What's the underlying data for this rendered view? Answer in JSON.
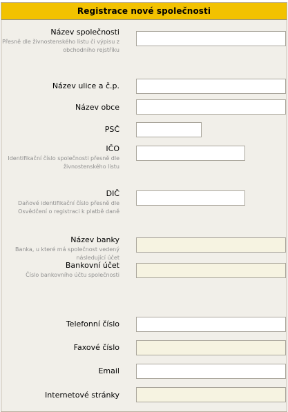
{
  "form": {
    "title": "Registrace nové společnosti",
    "fields": [
      {
        "label": "Název společnosti",
        "hint": "Přesně dle živnostenského listu či výpisu z obchodního rejstříku",
        "value": ""
      },
      {
        "label": "Název ulice a č.p.",
        "value": ""
      },
      {
        "label": "Název obce",
        "value": ""
      },
      {
        "label": "PSČ",
        "value": ""
      },
      {
        "label": "IČO",
        "hint": "Identifikační číslo společnosti přesně dle živnostenského listu",
        "value": ""
      },
      {
        "label": "DIČ",
        "hint": "Daňové identifikační číslo přesně dle Osvědčení o registraci k platbě daně",
        "value": ""
      },
      {
        "label": "Název banky",
        "hint": "Banka, u které má společnost vedený následující účet",
        "value": ""
      },
      {
        "label": "Bankovní účet",
        "hint": "Číslo bankovního účtu společnosti",
        "value": ""
      },
      {
        "label": "Telefonní číslo",
        "value": ""
      },
      {
        "label": "Faxové číslo",
        "value": ""
      },
      {
        "label": "Email",
        "value": ""
      },
      {
        "label": "Internetové stránky",
        "value": ""
      }
    ]
  },
  "colors": {
    "header_background": "#f2c200",
    "panel_background": "#f1efe9",
    "highlighted_input_background": "#f6f3e1",
    "hint_text": "#8f8f8f"
  }
}
